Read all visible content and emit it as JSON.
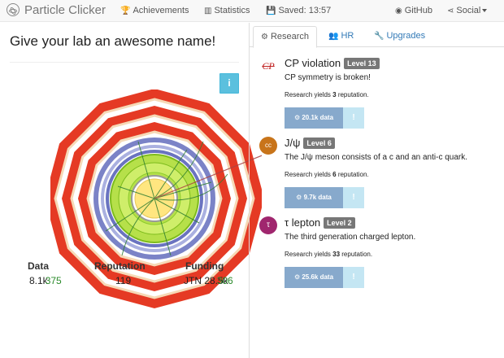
{
  "navbar": {
    "brand": "Particle Clicker",
    "achievements": "Achievements",
    "statistics": "Statistics",
    "saved": "Saved: 13:57",
    "github": "GitHub",
    "social": "Social"
  },
  "lab": {
    "name": "Give your lab an awesome name!",
    "info_label": "i"
  },
  "stats": {
    "data": {
      "label": "Data",
      "value": "8.1k",
      "delta": "375"
    },
    "reputation": {
      "label": "Reputation",
      "value": "119"
    },
    "funding": {
      "label": "Funding",
      "value": "JTN 28.5k",
      "delta": "306"
    }
  },
  "tabs": [
    {
      "label": "Research",
      "active": true
    },
    {
      "label": "HR",
      "active": false
    },
    {
      "label": "Upgrades",
      "active": false
    }
  ],
  "research": [
    {
      "name": "CP violation",
      "level": "Level 13",
      "description": "CP symmetry is broken!",
      "yield_prefix": "Research yields ",
      "yield_value": "3",
      "yield_suffix": " reputation.",
      "cost": "20.1k data",
      "info": "!",
      "icon_text": "CP",
      "icon_color": "#ffffff"
    },
    {
      "name": "J/ψ",
      "level": "Level 6",
      "description": "The J/ψ meson consists of a c and an anti-c quark.",
      "yield_prefix": "Research yields ",
      "yield_value": "6",
      "yield_suffix": " reputation.",
      "cost": "9.7k data",
      "info": "!",
      "icon_text": "cc",
      "icon_color": "#c8741a"
    },
    {
      "name": "τ lepton",
      "level": "Level 2",
      "description": "The third generation charged lepton.",
      "yield_prefix": "Research yields ",
      "yield_value": "33",
      "yield_suffix": " reputation.",
      "cost": "25.6k data",
      "info": "!",
      "icon_text": "τ",
      "icon_color": "#a0266e"
    }
  ]
}
